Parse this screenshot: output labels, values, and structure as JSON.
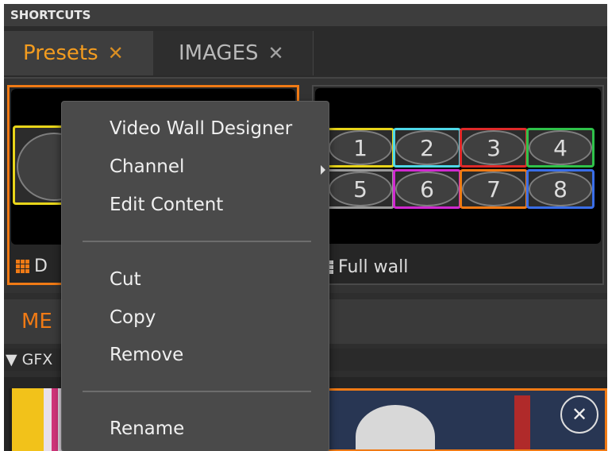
{
  "shortcuts_title": "SHORTCUTS",
  "tabs": [
    {
      "label": "Presets",
      "close": "✕",
      "active": true
    },
    {
      "label": "IMAGES",
      "close": "✕",
      "active": false
    }
  ],
  "presets": {
    "left_label_visible": "D",
    "right_label": "Full wall",
    "cells": [
      {
        "n": "1",
        "color": "#e8d51a"
      },
      {
        "n": "2",
        "color": "#4fd8e8"
      },
      {
        "n": "3",
        "color": "#e02a2a"
      },
      {
        "n": "4",
        "color": "#2fc24a"
      },
      {
        "n": "5",
        "color": "#9a9a9a"
      },
      {
        "n": "6",
        "color": "#d02ad0"
      },
      {
        "n": "7",
        "color": "#f07a15"
      },
      {
        "n": "8",
        "color": "#3a6ee8"
      }
    ]
  },
  "media_bar_text": "ME",
  "gfx_bar_text": "▼ GFX",
  "context_menu": {
    "group1": [
      "Video Wall Designer",
      "Channel",
      "Edit Content"
    ],
    "group2": [
      "Cut",
      "Copy",
      "Remove"
    ],
    "group3": [
      "Rename"
    ]
  },
  "colors": {
    "accent": "#f07a15",
    "active_tab_text": "#f39c1f"
  }
}
